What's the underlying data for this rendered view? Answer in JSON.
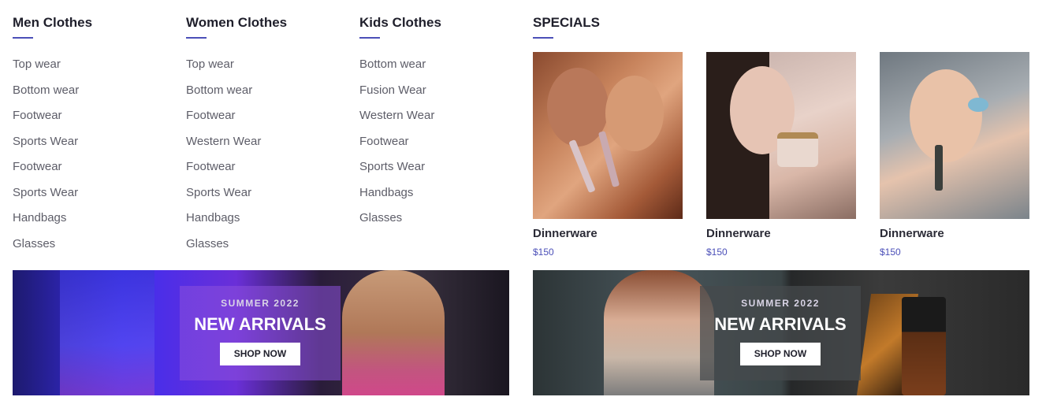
{
  "columns": {
    "men": {
      "title": "Men Clothes",
      "items": [
        "Top wear",
        "Bottom wear",
        "Footwear",
        "Sports Wear",
        "Footwear",
        "Sports Wear",
        "Handbags",
        "Glasses"
      ]
    },
    "women": {
      "title": "Women Clothes",
      "items": [
        "Top wear",
        "Bottom wear",
        "Footwear",
        "Western Wear",
        "Footwear",
        "Sports Wear",
        "Handbags",
        "Glasses"
      ]
    },
    "kids": {
      "title": "Kids Clothes",
      "items": [
        "Bottom wear",
        "Fusion Wear",
        "Western Wear",
        "Footwear",
        "Sports Wear",
        "Handbags",
        "Glasses"
      ]
    }
  },
  "specials": {
    "title": "SPECIALS",
    "products": [
      {
        "name": "Dinnerware",
        "price": "$150"
      },
      {
        "name": "Dinnerware",
        "price": "$150"
      },
      {
        "name": "Dinnerware",
        "price": "$150"
      }
    ]
  },
  "banners": [
    {
      "kicker": "SUMMER 2022",
      "title": "NEW ARRIVALS",
      "button": "SHOP NOW"
    },
    {
      "kicker": "SUMMER 2022",
      "title": "NEW ARRIVALS",
      "button": "SHOP NOW"
    }
  ],
  "colors": {
    "accent": "#4b4fb8",
    "heading": "#1f1f2b",
    "link": "#5d5d68"
  }
}
